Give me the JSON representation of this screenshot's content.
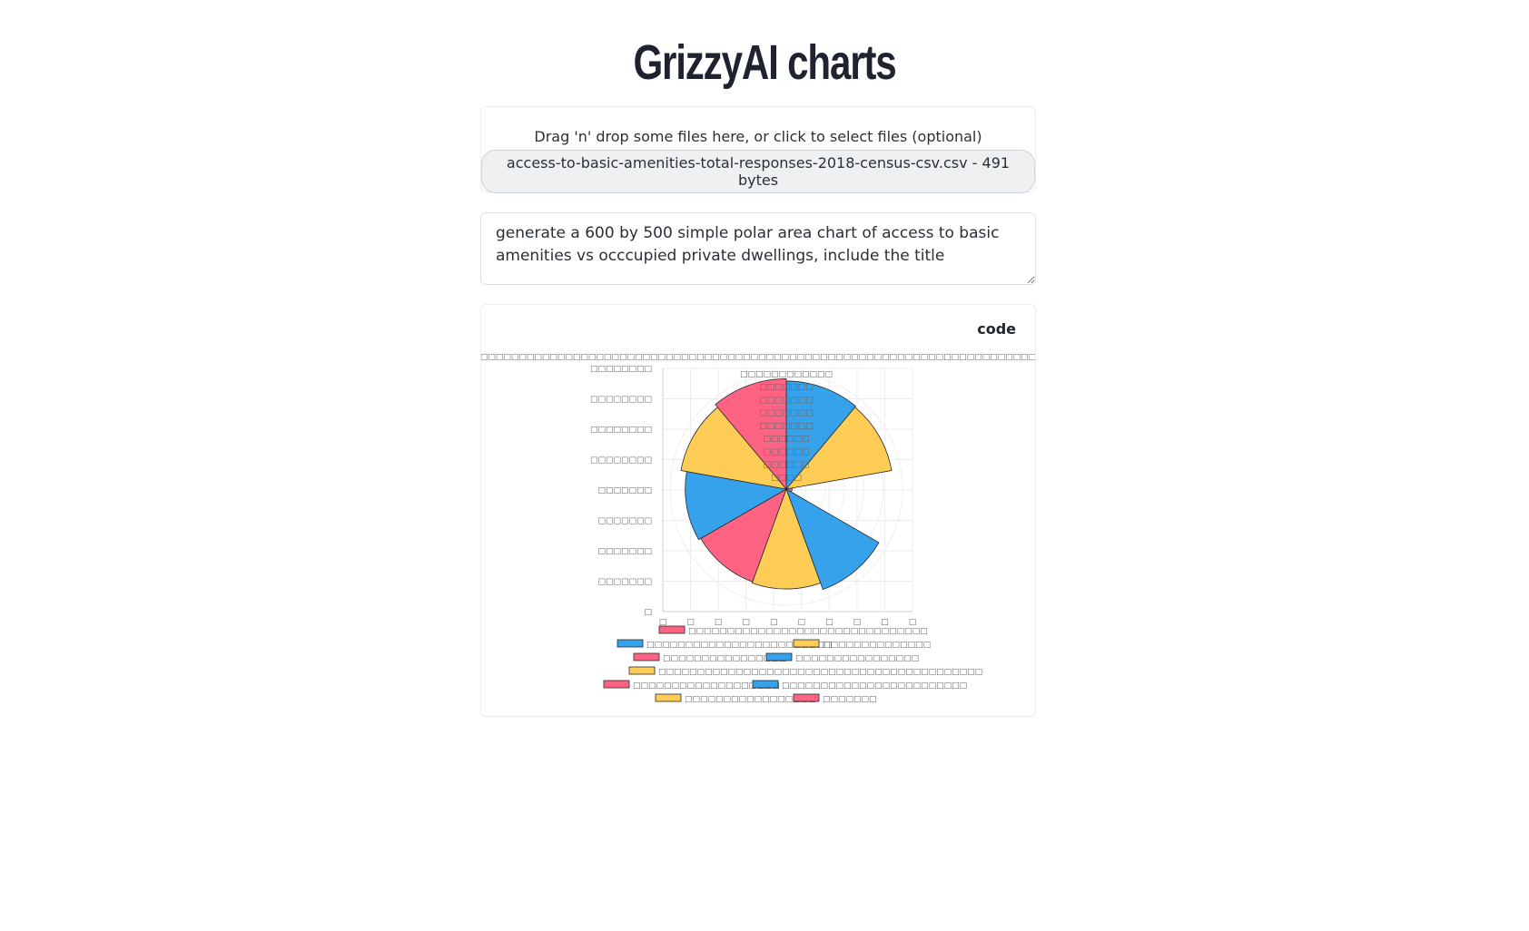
{
  "app": {
    "title": "GrizzyAI charts"
  },
  "dropzone": {
    "hint": "Drag 'n' drop some files here, or click to select files (optional)",
    "file": "access-to-basic-amenities-total-responses-2018-census-csv.csv - 491 bytes"
  },
  "prompt": {
    "value": "generate a 600 by 500 simple polar area chart of access to basic amenities vs occcupied private dwellings, include the title"
  },
  "chart_card": {
    "code_label": "code"
  },
  "colors": {
    "red": "#ff6384",
    "blue": "#36a2eb",
    "yellow": "#ffcd56"
  },
  "chart_data": {
    "type": "polarArea",
    "title": "□□□□□□□□□□□□□□□□□□□□□□□□□□□□□□□□□□□□□□□□□□□□□□□□□□□□□□□□□□□□□□□□□□□□□□□□□□",
    "y_ticks": [
      "□□□□□□□□",
      "□□□□□□□□",
      "□□□□□□□□",
      "□□□□□□□□",
      "□□□□□□□",
      "□□□□□□□",
      "□□□□□□□",
      "□□□□□□□",
      "□"
    ],
    "x_ticks": [
      "□",
      "□",
      "□",
      "□",
      "□",
      "□",
      "□",
      "□",
      "□",
      "□"
    ],
    "radial_ticks": [
      "□□□□□□□□□□□□",
      "□□□□□□□",
      "□□□□□□□",
      "□□□□□□□",
      "□□□□□□□",
      "□□□□□□",
      "□□□□□□",
      "□□□□□□",
      "□□□□"
    ],
    "segment_values": [
      0.93,
      0.92,
      0.05,
      0.92,
      0.86,
      0.85,
      0.87,
      0.92,
      0.95
    ],
    "segment_colors": [
      "#36a2eb",
      "#ffcd56",
      "#ff6384",
      "#36a2eb",
      "#ffcd56",
      "#ff6384",
      "#36a2eb",
      "#ffcd56",
      "#ff6384"
    ],
    "legend": [
      {
        "label": "□□□□□□□□□□□□□□□□□□□□□□□□□□□□□□□",
        "color": "#ff6384"
      },
      {
        "label": "□□□□□□□□□□□□□□□□□□□□□□□□",
        "color": "#36a2eb"
      },
      {
        "label": "□□□□□□□□□□□□□□",
        "color": "#ffcd56"
      },
      {
        "label": "□□□□□□□□□□□□□□□□",
        "color": "#ff6384"
      },
      {
        "label": "□□□□□□□□□□□□□□□□",
        "color": "#36a2eb"
      },
      {
        "label": "□□□□□□□□□□□□□□□□□□□□□□□□□□□□□□□□□□□□□□□□□□",
        "color": "#ffcd56"
      },
      {
        "label": "□□□□□□□□□□□□□□□□□□□",
        "color": "#ff6384"
      },
      {
        "label": "□□□□□□□□□□□□□□□□□□□□□□□□",
        "color": "#36a2eb"
      },
      {
        "label": "□□□□□□□□□□□□□□□□□",
        "color": "#ffcd56"
      },
      {
        "label": "□□□□□□□",
        "color": "#ff6384"
      }
    ]
  }
}
